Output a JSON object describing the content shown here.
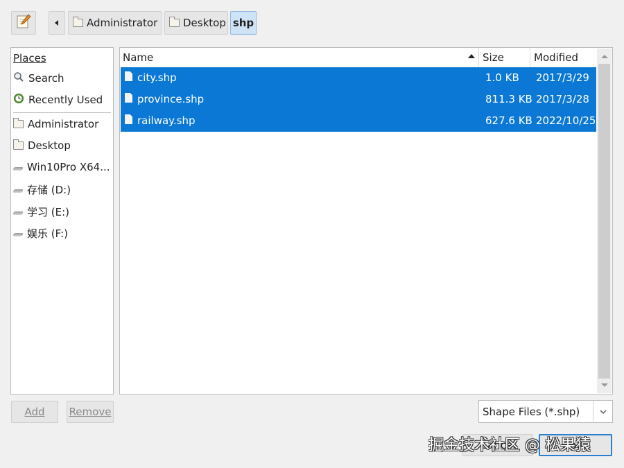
{
  "toolbar": {
    "edit_icon": "pencil-notepad-icon",
    "back_icon": "triangle-left-icon",
    "breadcrumbs": [
      {
        "label": "Administrator",
        "icon": "folder-icon"
      },
      {
        "label": "Desktop",
        "icon": "folder-icon"
      },
      {
        "label": "shp",
        "active": true
      }
    ]
  },
  "places": {
    "header": "Places",
    "items": [
      {
        "label": "Search",
        "icon": "magnifier-icon"
      },
      {
        "label": "Recently Used",
        "icon": "clock-icon"
      },
      {
        "label": "Administrator",
        "icon": "folder-icon"
      },
      {
        "label": "Desktop",
        "icon": "folder-icon"
      },
      {
        "label": "Win10Pro X64...",
        "icon": "drive-icon"
      },
      {
        "label": "存储 (D:)",
        "icon": "drive-icon"
      },
      {
        "label": "学习 (E:)",
        "icon": "drive-icon"
      },
      {
        "label": "娱乐 (F:)",
        "icon": "drive-icon"
      }
    ]
  },
  "files": {
    "columns": {
      "name": "Name",
      "size": "Size",
      "modified": "Modified"
    },
    "rows": [
      {
        "name": "city.shp",
        "size": "1.0 KB",
        "modified": "2017/3/29",
        "selected": true
      },
      {
        "name": "province.shp",
        "size": "811.3 KB",
        "modified": "2017/3/28",
        "selected": true
      },
      {
        "name": "railway.shp",
        "size": "627.6 KB",
        "modified": "2022/10/25",
        "selected": true
      }
    ]
  },
  "buttons": {
    "add_label": "Add",
    "remove_label": "Remove",
    "cancel_label": "Cancel",
    "open_label": "Open"
  },
  "filter": {
    "value": "Shape Files (*.shp)"
  },
  "watermark": "掘金技术社区 @ 松果猿",
  "colors": {
    "selection": "#0a78d4",
    "background": "#f0f0f0",
    "active_crumb": "#cfe3f6"
  }
}
